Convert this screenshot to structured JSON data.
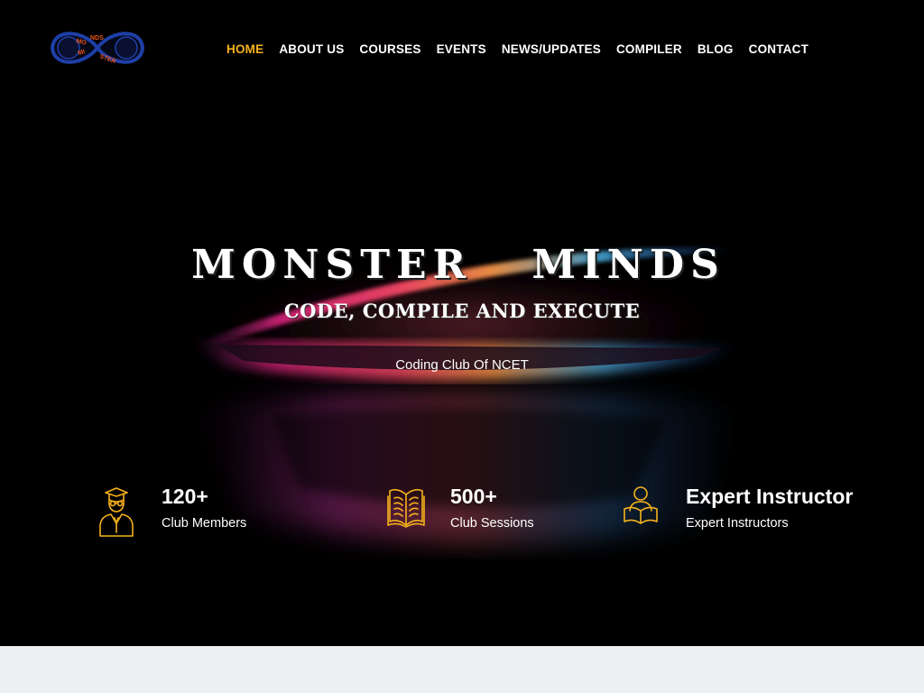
{
  "header": {
    "logo_text": "MONSTER MINDS",
    "nav": [
      {
        "label": "HOME",
        "active": true
      },
      {
        "label": "ABOUT US",
        "active": false
      },
      {
        "label": "COURSES",
        "active": false
      },
      {
        "label": "EVENTS",
        "active": false
      },
      {
        "label": "NEWS/UPDATES",
        "active": false
      },
      {
        "label": "COMPILER",
        "active": false
      },
      {
        "label": "BLOG",
        "active": false
      },
      {
        "label": "CONTACT",
        "active": false
      }
    ]
  },
  "hero": {
    "title": "MONSTER MINDS",
    "subtitle": "CODE, COMPILE AND EXECUTE",
    "tagline": "Coding Club Of NCET"
  },
  "stats": [
    {
      "icon": "graduate-icon",
      "value": "120+",
      "label": "Club Members"
    },
    {
      "icon": "open-book-icon",
      "value": "500+",
      "label": "Club Sessions"
    },
    {
      "icon": "instructor-reading-icon",
      "value": "Expert Instructor",
      "label": "Expert Instructors"
    }
  ],
  "colors": {
    "accent": "#f6b21b",
    "background": "#000000",
    "text": "#ffffff",
    "logo_blue": "#1f3fa8",
    "logo_orange": "#e8541c",
    "next_section_bg": "#edf0f3"
  }
}
